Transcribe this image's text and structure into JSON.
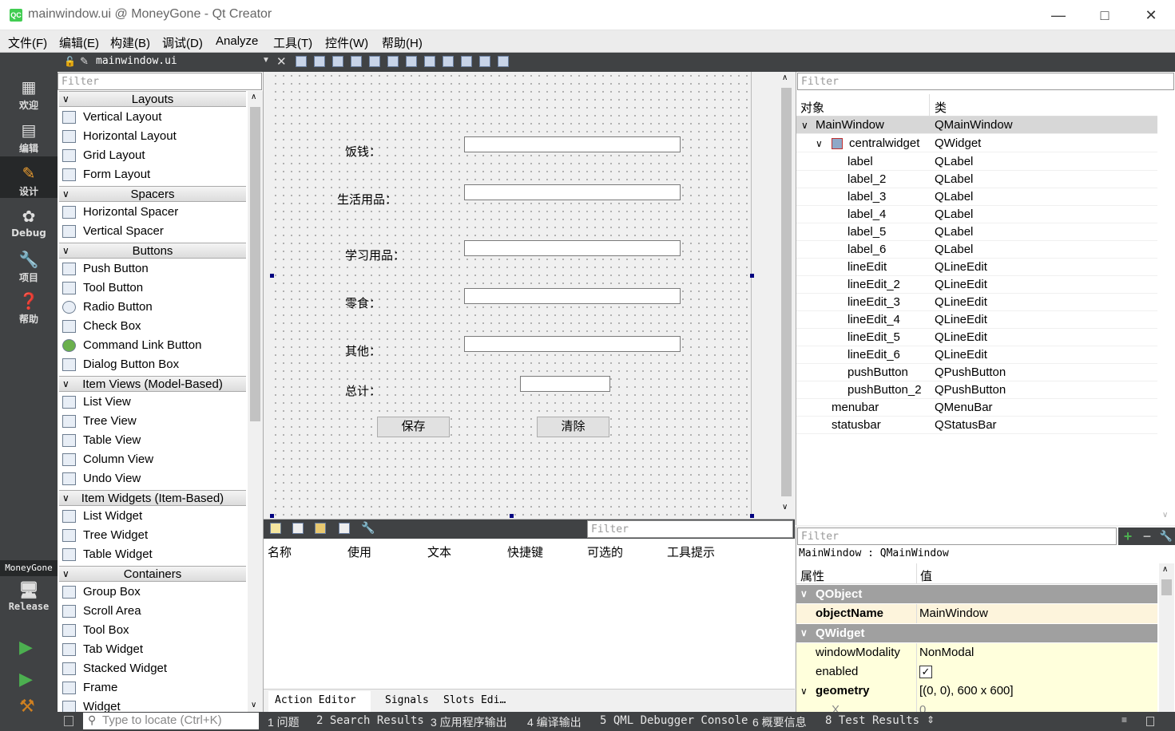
{
  "window": {
    "title": "mainwindow.ui @ MoneyGone - Qt Creator",
    "app_icon": "QC"
  },
  "menu": [
    "文件(F)",
    "编辑(E)",
    "构建(B)",
    "调试(D)",
    "Analyze",
    "工具(T)",
    "控件(W)",
    "帮助(H)"
  ],
  "modes": [
    "欢迎",
    "编辑",
    "设计",
    "Debug",
    "项目",
    "帮助"
  ],
  "target": {
    "project": "MoneyGone",
    "config": "Release"
  },
  "editor": {
    "filename": "mainwindow.ui"
  },
  "widgetbox": {
    "filter_placeholder": "Filter",
    "categories": {
      "layouts": "Layouts",
      "spacers": "Spacers",
      "buttons": "Buttons",
      "item_views": "Item Views (Model-Based)",
      "item_widgets": "Item Widgets (Item-Based)",
      "containers": "Containers"
    },
    "items": {
      "vertical_layout": "Vertical Layout",
      "horizontal_layout": "Horizontal Layout",
      "grid_layout": "Grid Layout",
      "form_layout": "Form Layout",
      "horizontal_spacer": "Horizontal Spacer",
      "vertical_spacer": "Vertical Spacer",
      "push_button": "Push Button",
      "tool_button": "Tool Button",
      "radio_button": "Radio Button",
      "check_box": "Check Box",
      "command_link_button": "Command Link Button",
      "dialog_button_box": "Dialog Button Box",
      "list_view": "List View",
      "tree_view": "Tree View",
      "table_view": "Table View",
      "column_view": "Column View",
      "undo_view": "Undo View",
      "list_widget": "List Widget",
      "tree_widget": "Tree Widget",
      "table_widget": "Table Widget",
      "group_box": "Group Box",
      "scroll_area": "Scroll Area",
      "tool_box": "Tool Box",
      "tab_widget": "Tab Widget",
      "stacked_widget": "Stacked Widget",
      "frame": "Frame",
      "widget": "Widget"
    }
  },
  "form": {
    "labels": [
      "饭钱：",
      "生活用品：",
      "学习用品：",
      "零食：",
      "其他：",
      "总计："
    ],
    "buttons": {
      "save": "保存",
      "clear": "清除"
    }
  },
  "action_editor": {
    "filter_placeholder": "Filter",
    "columns": [
      "名称",
      "使用",
      "文本",
      "快捷键",
      "可选的",
      "工具提示"
    ],
    "tabs": {
      "action_editor": "Action Editor",
      "signals": "Signals",
      "slots": "Slots Edi…"
    }
  },
  "object_inspector": {
    "filter_placeholder": "Filter",
    "headers": {
      "object": "对象",
      "class": "类"
    },
    "rows": [
      {
        "name": "MainWindow",
        "cls": "QMainWindow"
      },
      {
        "name": "centralwidget",
        "cls": "QWidget"
      },
      {
        "name": "label",
        "cls": "QLabel"
      },
      {
        "name": "label_2",
        "cls": "QLabel"
      },
      {
        "name": "label_3",
        "cls": "QLabel"
      },
      {
        "name": "label_4",
        "cls": "QLabel"
      },
      {
        "name": "label_5",
        "cls": "QLabel"
      },
      {
        "name": "label_6",
        "cls": "QLabel"
      },
      {
        "name": "lineEdit",
        "cls": "QLineEdit"
      },
      {
        "name": "lineEdit_2",
        "cls": "QLineEdit"
      },
      {
        "name": "lineEdit_3",
        "cls": "QLineEdit"
      },
      {
        "name": "lineEdit_4",
        "cls": "QLineEdit"
      },
      {
        "name": "lineEdit_5",
        "cls": "QLineEdit"
      },
      {
        "name": "lineEdit_6",
        "cls": "QLineEdit"
      },
      {
        "name": "pushButton",
        "cls": "QPushButton"
      },
      {
        "name": "pushButton_2",
        "cls": "QPushButton"
      },
      {
        "name": "menubar",
        "cls": "QMenuBar"
      },
      {
        "name": "statusbar",
        "cls": "QStatusBar"
      }
    ]
  },
  "property_editor": {
    "filter_placeholder": "Filter",
    "context": "MainWindow : QMainWindow",
    "headers": {
      "property": "属性",
      "value": "值"
    },
    "groups": {
      "qobject": "QObject",
      "qwidget": "QWidget"
    },
    "rows": {
      "objectName": {
        "name": "objectName",
        "value": "MainWindow"
      },
      "windowModality": {
        "name": "windowModality",
        "value": "NonModal"
      },
      "enabled": {
        "name": "enabled",
        "value": "✓"
      },
      "geometry": {
        "name": "geometry",
        "value": "[(0, 0), 600 x 600]"
      },
      "x": {
        "name": "X",
        "value": "0"
      }
    }
  },
  "statusbar": {
    "locate_placeholder": "Type to locate (Ctrl+K)",
    "panes": [
      "1 问题",
      "2 Search Results",
      "3 应用程序输出",
      "4 编译输出",
      "5 QML Debugger Console",
      "6 概要信息",
      "8 Test Results"
    ]
  },
  "colors": {
    "dark": "#404244",
    "selection": "#d7d7d7",
    "prop_highlight": "#fdf4dc",
    "prop_yellow": "#ffffdc",
    "group": "#a0a0a0"
  }
}
